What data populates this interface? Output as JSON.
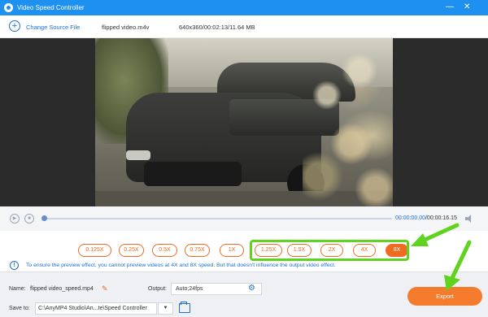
{
  "window": {
    "title": "Video Speed Controller"
  },
  "toolbar": {
    "change_source_label": "Change Source File",
    "filename": "flipped video.m4v",
    "fileinfo": "640x360/00:02:13/11.64 MB"
  },
  "player": {
    "current_time": "00:00:00.00",
    "total_time": "/00:00:16.15",
    "progress": 0.0
  },
  "speeds": {
    "options": [
      "0.125X",
      "0.25X",
      "0.5X",
      "0.75X",
      "1X",
      "1.25X",
      "1.5X",
      "2X",
      "4X",
      "8X"
    ],
    "selected": "8X",
    "notice": "To ensure the preview effect, you cannot preview videos at 4X and 8X speed. But that doesn't influence the output video effect."
  },
  "output": {
    "name_label": "Name:",
    "name_value": "flipped video_speed.mp4",
    "output_label": "Output:",
    "output_value": "Auto;24fps",
    "saveto_label": "Save to:",
    "saveto_value": "C:\\AnyMP4 Studio\\An...te\\Speed Controller",
    "export_label": "Export"
  },
  "colors": {
    "accent": "#1e90f0",
    "speed_accent": "#f06a1f",
    "annotation": "#5fd31e"
  }
}
